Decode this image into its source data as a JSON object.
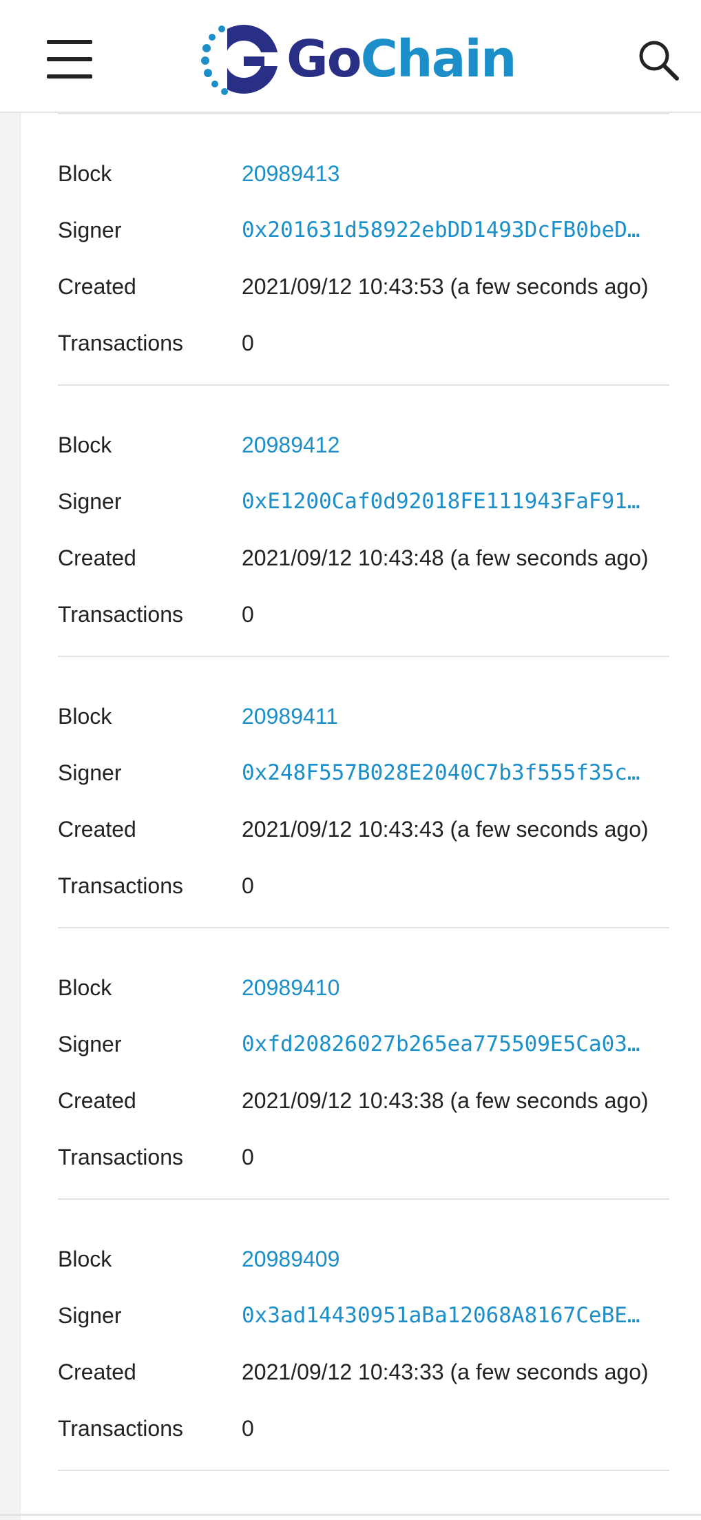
{
  "header": {
    "logo_go": "Go",
    "logo_chain": "Chain",
    "menu_icon": "hamburger-menu-icon",
    "search_icon": "search-icon",
    "logo_icon": "gochain-logo-icon"
  },
  "labels": {
    "block": "Block",
    "signer": "Signer",
    "created": "Created",
    "transactions": "Transactions"
  },
  "blocks": [
    {
      "number": "20989413",
      "signer": "0x201631d58922ebDD1493DcFB0beD…",
      "created": "2021/09/12 10:43:53 (a few seconds ago)",
      "transactions": "0"
    },
    {
      "number": "20989412",
      "signer": "0xE1200Caf0d92018FE111943FaF91…",
      "created": "2021/09/12 10:43:48 (a few seconds ago)",
      "transactions": "0"
    },
    {
      "number": "20989411",
      "signer": "0x248F557B028E2040C7b3f555f35c…",
      "created": "2021/09/12 10:43:43 (a few seconds ago)",
      "transactions": "0"
    },
    {
      "number": "20989410",
      "signer": "0xfd20826027b265ea775509E5Ca03…",
      "created": "2021/09/12 10:43:38 (a few seconds ago)",
      "transactions": "0"
    },
    {
      "number": "20989409",
      "signer": "0x3ad14430951aBa12068A8167CeBE…",
      "created": "2021/09/12 10:43:33 (a few seconds ago)",
      "transactions": "0"
    }
  ],
  "colors": {
    "brand_dark": "#2a2f86",
    "brand_light": "#1c8fc9",
    "link": "#1c8fc9",
    "text": "#222222"
  }
}
